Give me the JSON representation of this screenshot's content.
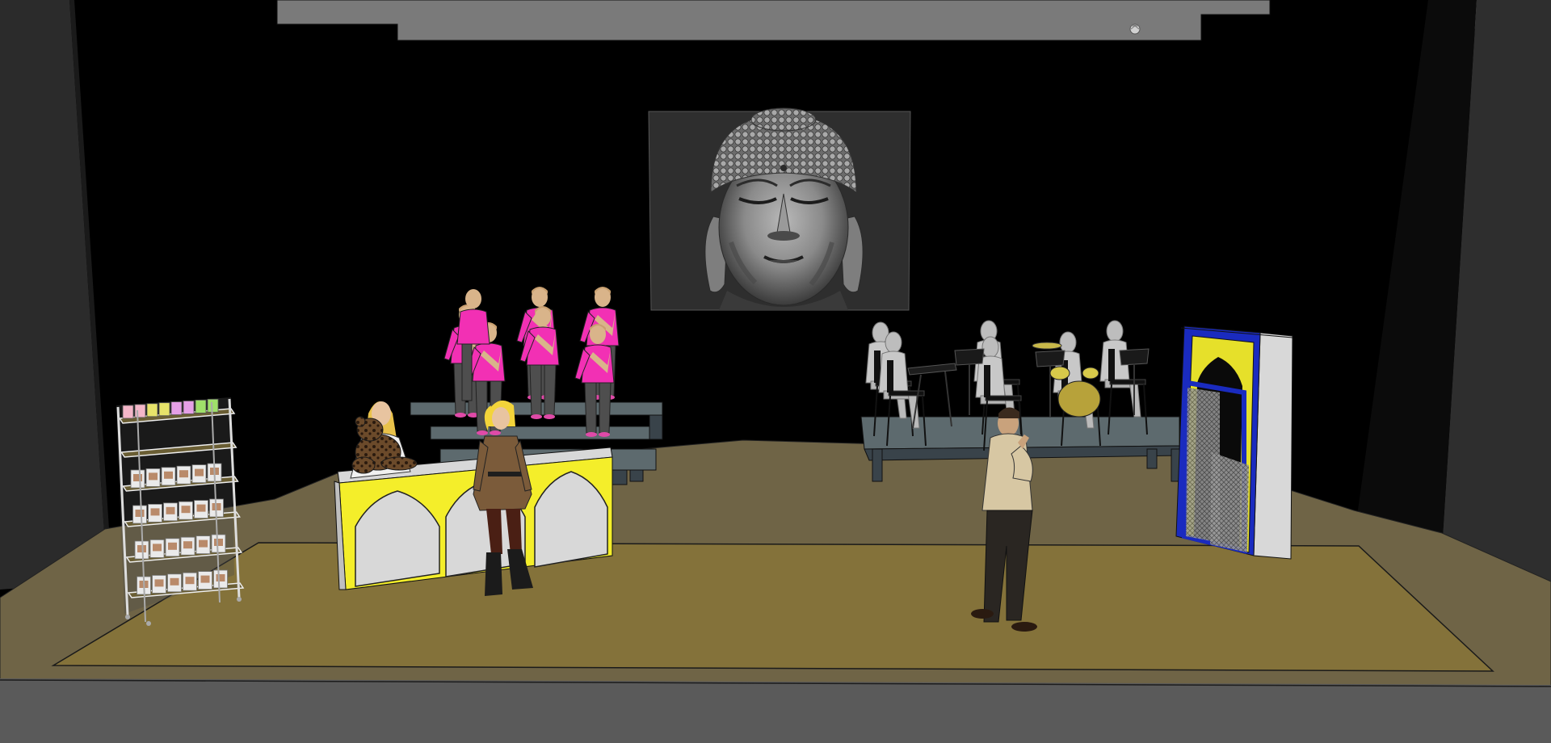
{
  "scene": {
    "type": "stage-set-3d-model",
    "colors": {
      "backdrop": "#000000",
      "wing_left": "#2b2b2b",
      "wing_right": "#2e2e2e",
      "header": "#7a7a7a",
      "floor": "#6f6446",
      "rug": "#84723a",
      "apron": "#5a5a5a",
      "platform_top": "#5d6a6e",
      "platform_side": "#39434a",
      "choir_shirt": "#f230b4",
      "counter_yellow": "#f4ee2a",
      "counter_panel": "#d8d8d8",
      "arch_blue": "#1a2bbf",
      "arch_yellow": "#e6e02a",
      "man_shirt": "#d7c7a3",
      "man_pants": "#2a2622"
    },
    "objects": [
      {
        "name": "buddha-projection-screen",
        "icon": "buddha-head-image"
      },
      {
        "name": "choir-risers",
        "performers": 7
      },
      {
        "name": "band-platform",
        "musicians": 6
      },
      {
        "name": "decorated-counter",
        "arches": 3
      },
      {
        "name": "display-shelf",
        "shelves": 5
      },
      {
        "name": "arched-doorway"
      },
      {
        "name": "woman-in-brown-coat"
      },
      {
        "name": "thinking-man"
      },
      {
        "name": "shopkeeper-with-teddy-bear"
      },
      {
        "name": "stage-light",
        "icon": "spotlight-icon"
      }
    ]
  }
}
